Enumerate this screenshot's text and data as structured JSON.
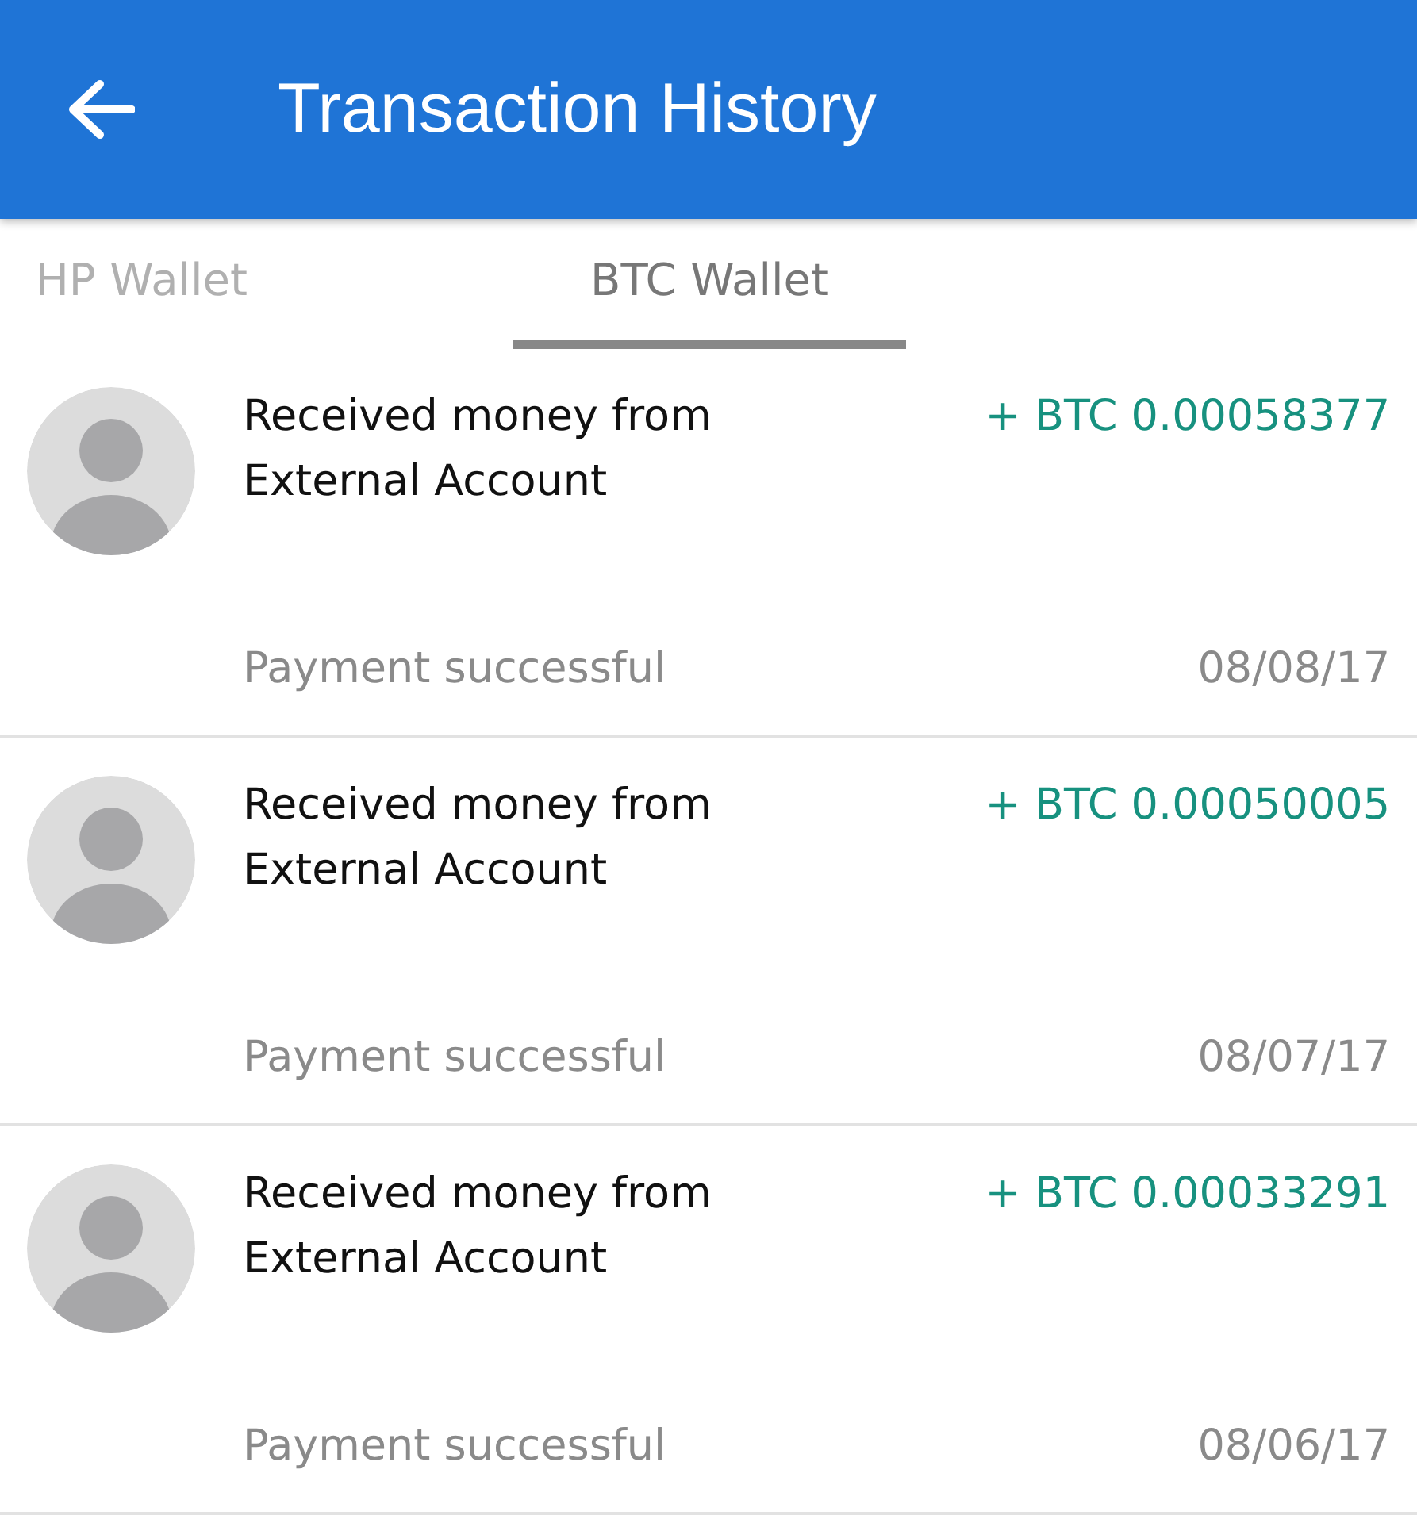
{
  "app_bar": {
    "title": "Transaction History"
  },
  "tabs": [
    {
      "label": "HP Wallet",
      "selected": false
    },
    {
      "label": "BTC Wallet",
      "selected": true
    }
  ],
  "transactions": [
    {
      "title": "Received money from External Account",
      "amount": "+ BTC 0.00058377",
      "status": "Payment successful",
      "date": "08/08/17"
    },
    {
      "title": "Received money from External Account",
      "amount": "+ BTC 0.00050005",
      "status": "Payment successful",
      "date": "08/07/17"
    },
    {
      "title": "Received money from External Account",
      "amount": "+ BTC 0.00033291",
      "status": "Payment successful",
      "date": "08/06/17"
    }
  ]
}
